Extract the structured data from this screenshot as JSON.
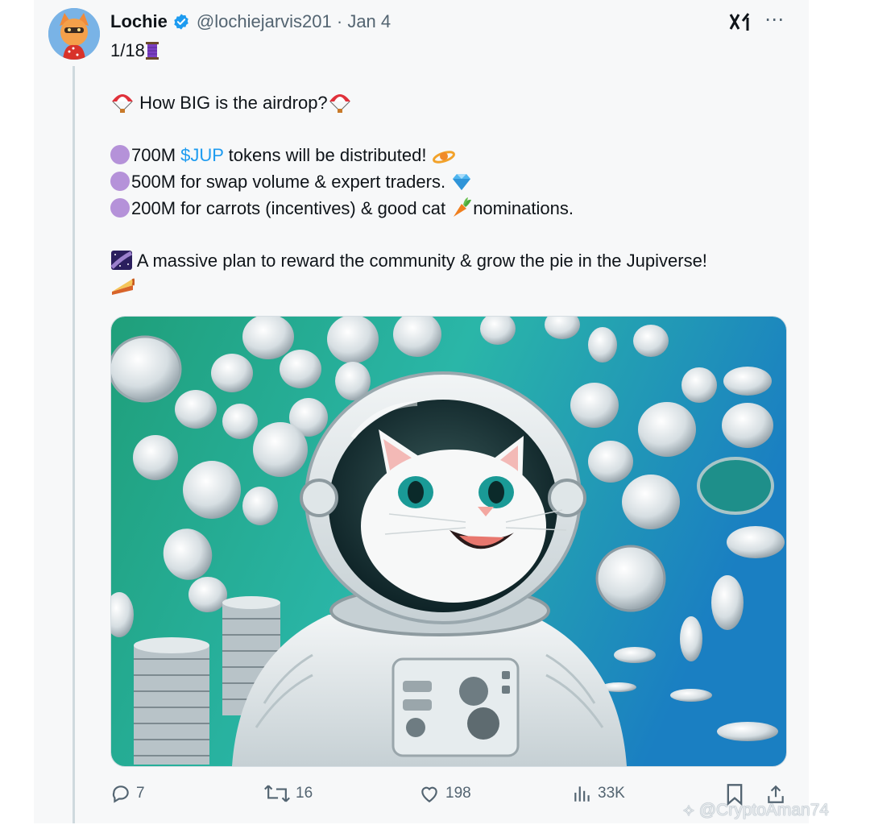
{
  "tweet": {
    "author_name": "Lochie",
    "handle_date": "@lochiejarvis201 · Jan 4",
    "thread_counter": "1/18",
    "headline": "How BIG is the airdrop?",
    "line1_pre": "700M ",
    "line1_link": "$JUP",
    "line1_post": " tokens will be distributed!",
    "line2": "500M for swap volume & expert traders.",
    "line3_pre": "200M for carrots (incentives) & good cat",
    "line3_post": "nominations.",
    "closing": "A massive plan to reward the community & grow the pie in the Jupiverse!"
  },
  "actions": {
    "replies": "7",
    "reposts": "16",
    "likes": "198",
    "views": "33K"
  },
  "watermark": "@CryptoAman74",
  "colors": {
    "link": "#1d9bf0",
    "muted": "#536471",
    "verified": "#1d9bf0",
    "bullet": "#b592d9"
  },
  "icons": [
    "verified-badge-icon",
    "grok-icon",
    "more-icon",
    "parachute-icon",
    "thread-spool-icon",
    "reply-icon",
    "repost-icon",
    "like-icon",
    "views-icon",
    "bookmark-icon",
    "share-icon"
  ]
}
